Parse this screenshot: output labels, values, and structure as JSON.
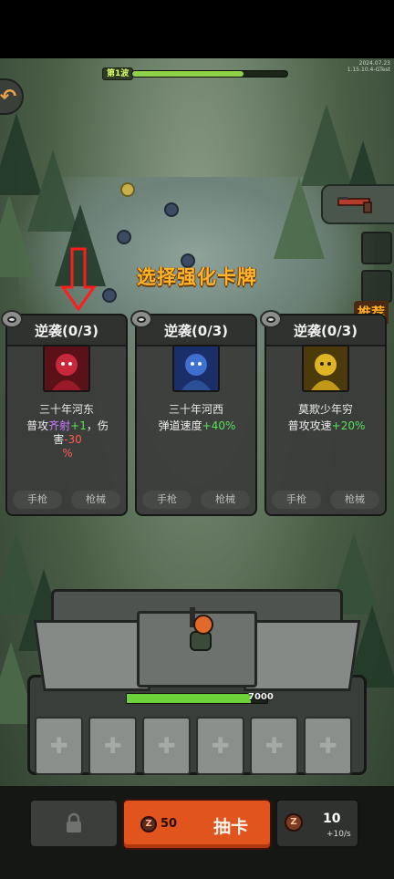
{
  "game": {
    "version_line1": "2024.07.23",
    "version_line2": "1.15.10.4-GTest",
    "wave_label": "第1波",
    "wave_progress": 0.72,
    "title": "选择强化卡牌",
    "recommend_label": "推荐",
    "hp_value": "7000",
    "hp_fraction": 0.88
  },
  "cards": [
    {
      "title": "逆袭(0/3)",
      "name": "三十年河东",
      "desc_prefix": "普攻",
      "desc_highlight": "齐射",
      "desc_value": "+1",
      "desc_mid": "，伤害",
      "desc_value2": "-30",
      "desc_suffix": "%",
      "tag1": "手枪",
      "tag2": "枪械",
      "portrait_color": "#c8283a"
    },
    {
      "title": "逆袭(0/3)",
      "name": "三十年河西",
      "desc_prefix": "弹道速度",
      "desc_value": "+40%",
      "tag1": "手枪",
      "tag2": "枪械",
      "portrait_color": "#3f6fcf"
    },
    {
      "title": "逆袭(0/3)",
      "name": "莫欺少年穷",
      "desc_prefix": "普攻攻速",
      "desc_value": "+20%",
      "tag1": "手枪",
      "tag2": "枪械",
      "portrait_color": "#e0b524"
    }
  ],
  "bottom": {
    "draw_cost": "50",
    "draw_label": "抽卡",
    "resource_value": "10",
    "resource_rate": "+10/s",
    "coin_glyph": "Z"
  },
  "colors": {
    "accent_orange": "#e2541d",
    "title_gold": "#ffb429",
    "stat_green": "#57e05a"
  },
  "icons": [
    "back-arrow-icon",
    "eye-icon",
    "lock-icon",
    "coin-icon",
    "plus-icon",
    "gun-icon",
    "red-down-arrow-icon"
  ]
}
